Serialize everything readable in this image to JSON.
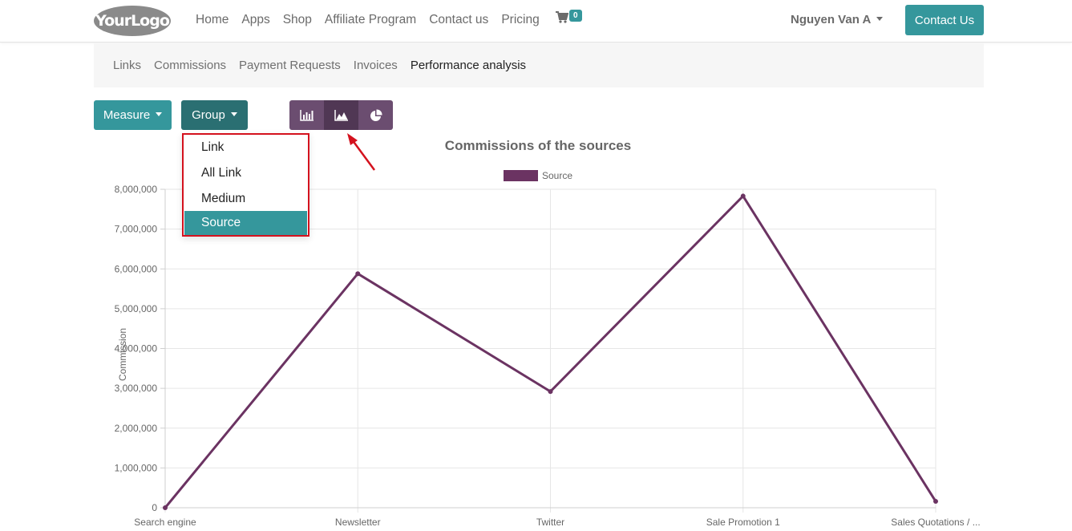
{
  "navbar": {
    "logo": "YourLogo",
    "links": [
      "Home",
      "Apps",
      "Shop",
      "Affiliate Program",
      "Contact us",
      "Pricing"
    ],
    "cart_count": "0",
    "user": "Nguyen Van A",
    "contact_button": "Contact Us"
  },
  "subnav": {
    "items": [
      "Links",
      "Commissions",
      "Payment Requests",
      "Invoices",
      "Performance analysis"
    ],
    "active": "Performance analysis"
  },
  "toolbar": {
    "measure_label": "Measure",
    "group_label": "Group",
    "view_icons": [
      "bar-chart-icon",
      "line-chart-icon",
      "pie-chart-icon"
    ],
    "active_view": "line-chart-icon"
  },
  "group_dropdown": {
    "items": [
      "Link",
      "All Link",
      "Medium",
      "Source"
    ],
    "selected": "Source"
  },
  "colors": {
    "primary": "#35979c",
    "primary_dark": "#2a6f72",
    "view_btn": "#6b4d70",
    "view_btn_active": "#503754",
    "series": "#6b3362",
    "highlight_box": "#d4121e",
    "arrow": "#d4121e"
  },
  "chart_data": {
    "type": "line",
    "title": "Commissions of the sources",
    "ylabel": "Commission",
    "xlabel": "",
    "categories": [
      "Search engine",
      "Newsletter",
      "Twitter",
      "Sale Promotion 1",
      "Sales Quotations / ..."
    ],
    "series": [
      {
        "name": "Source",
        "values": [
          0,
          5880000,
          2920000,
          7830000,
          160000
        ]
      }
    ],
    "ylim": [
      0,
      8000000
    ],
    "yticks": [
      "0",
      "1,000,000",
      "2,000,000",
      "3,000,000",
      "4,000,000",
      "5,000,000",
      "6,000,000",
      "7,000,000",
      "8,000,000"
    ],
    "grid": true,
    "legend": "top-center"
  }
}
